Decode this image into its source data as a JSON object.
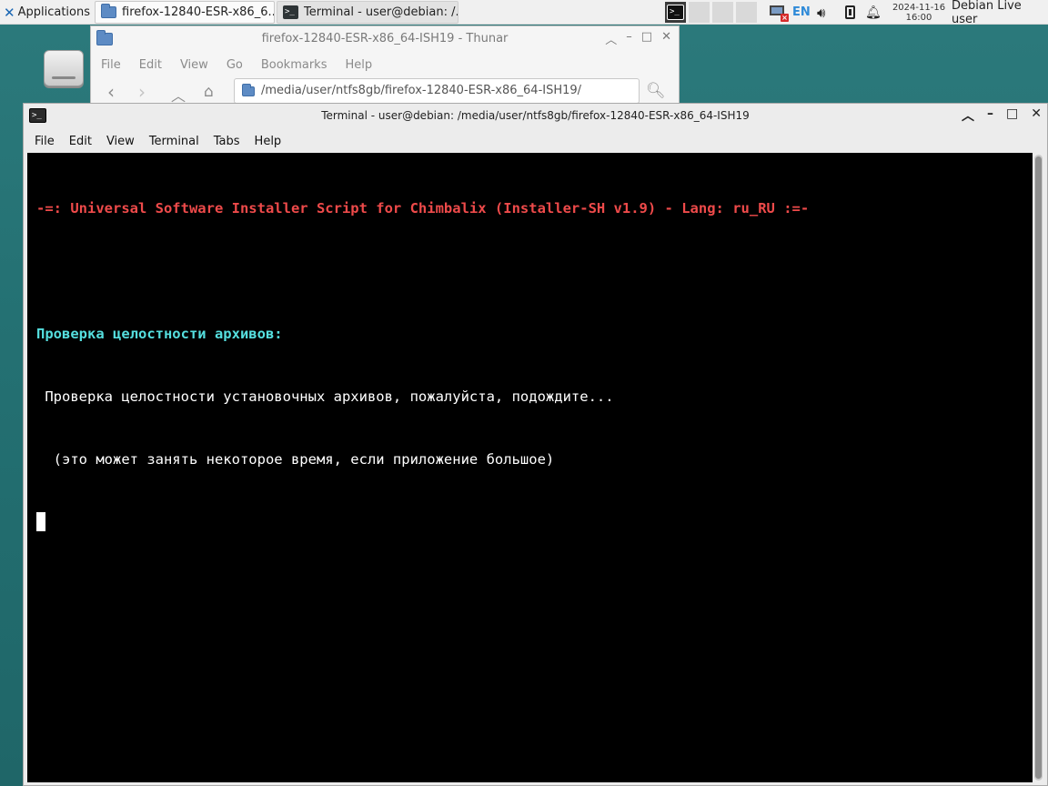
{
  "panel": {
    "applications_label": "Applications",
    "tasks": [
      {
        "label": "firefox-12840-ESR-x86_6..."
      },
      {
        "label": "Terminal - user@debian: /..."
      }
    ],
    "keyboard_layout": "EN",
    "clock_date": "2024-11-16",
    "clock_time": "16:00",
    "user_label": "Debian Live user"
  },
  "thunar": {
    "title": "firefox-12840-ESR-x86_64-ISH19 - Thunar",
    "menu": [
      "File",
      "Edit",
      "View",
      "Go",
      "Bookmarks",
      "Help"
    ],
    "location": "/media/user/ntfs8gb/firefox-12840-ESR-x86_64-ISH19/"
  },
  "terminal": {
    "title": "Terminal - user@debian: /media/user/ntfs8gb/firefox-12840-ESR-x86_64-ISH19",
    "menu": [
      "File",
      "Edit",
      "View",
      "Terminal",
      "Tabs",
      "Help"
    ],
    "lines": [
      "-=: Universal Software Installer Script for Chimbalix (Installer-SH v1.9) - Lang: ru_RU :=-",
      "",
      "Проверка целостности архивов:",
      " Проверка целостности установочных архивов, пожалуйста, подождите...",
      "  (это может занять некоторое время, если приложение большое)"
    ]
  },
  "colors": {
    "desktop": "#2c7a7c",
    "terminal_red": "#ee4a4a",
    "terminal_cyan": "#55dede",
    "terminal_bg": "#000000"
  },
  "icons": [
    "xfce-logo-icon",
    "folder-icon",
    "terminal-icon",
    "network-error-icon",
    "volume-icon",
    "battery-icon",
    "bell-icon",
    "drive-icon",
    "home-icon",
    "search-icon"
  ]
}
